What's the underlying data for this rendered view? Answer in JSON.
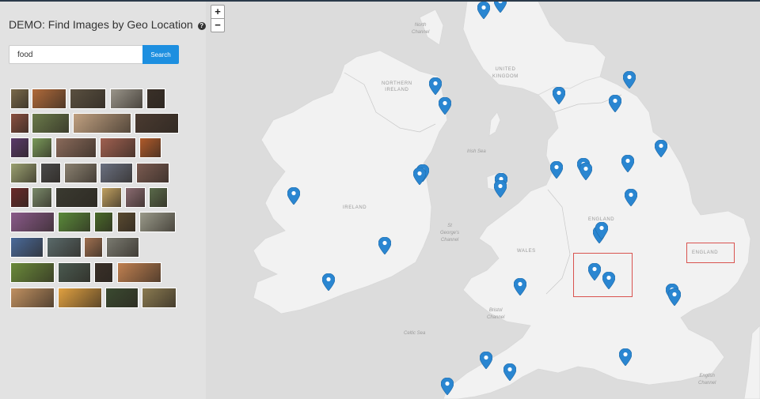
{
  "app": {
    "title": "DEMO: Find Images by Geo Location",
    "help_glyph": "?"
  },
  "search": {
    "value": "food",
    "button_label": "Search"
  },
  "thumbnails": [
    {
      "color": "#7a6a4a"
    },
    {
      "color": "#b06a3a"
    },
    {
      "color": "#5a5040"
    },
    {
      "color": "#9a958a"
    },
    {
      "color": "#3a3028"
    },
    {
      "color": "#8a5040"
    },
    {
      "color": "#6a7a4a"
    },
    {
      "color": "#c0a080"
    },
    {
      "color": "#4a3a30"
    },
    {
      "color": "#5a3a6a"
    },
    {
      "color": "#7a9a5a"
    },
    {
      "color": "#8a6a5a"
    },
    {
      "color": "#a06050"
    },
    {
      "color": "#b05a2a"
    },
    {
      "color": "#9aa070"
    },
    {
      "color": "#4a4a4a"
    },
    {
      "color": "#8a8070"
    },
    {
      "color": "#6a7080"
    },
    {
      "color": "#7a5a50"
    },
    {
      "color": "#6a2a2a"
    },
    {
      "color": "#7a8a6a"
    },
    {
      "color": "#3a3a30"
    },
    {
      "color": "#c0a060"
    },
    {
      "color": "#8a6a70"
    },
    {
      "color": "#5a6a4a"
    },
    {
      "color": "#8a5a8a"
    },
    {
      "color": "#5a8a3a"
    },
    {
      "color": "#4a6a2a"
    },
    {
      "color": "#5a4a30"
    },
    {
      "color": "#9a9a8a"
    },
    {
      "color": "#4a6a9a"
    },
    {
      "color": "#5a6a6a"
    },
    {
      "color": "#a07050"
    },
    {
      "color": "#7a7a70"
    },
    {
      "color": "#6a8a3a"
    },
    {
      "color": "#4a5a50"
    },
    {
      "color": "#3a3028"
    },
    {
      "color": "#c08050"
    },
    {
      "color": "#c09060"
    },
    {
      "color": "#e0a040"
    },
    {
      "color": "#3a4a30"
    },
    {
      "color": "#8a7a50"
    }
  ],
  "map": {
    "zoom_in": "+",
    "zoom_out": "−",
    "labels": {
      "northern_ireland": "NORTHERN\nIRELAND",
      "united_kingdom": "UNITED\nKINGDOM",
      "ireland": "IRELAND",
      "england_inland": "ENGLAND",
      "wales": "WALES",
      "england_highlight": "ENGLAND"
    },
    "sea_labels": {
      "north_channel": "North\nChannel",
      "irish_sea": "Irish Sea",
      "st_georges": "St\nGeorge's\nChannel",
      "bristol": "Bristol\nChannel",
      "celtic": "Celtic Sea",
      "english_channel": "English\nChannel"
    },
    "marker_color": "#2a86d1",
    "highlight_color": "#d9534f"
  }
}
